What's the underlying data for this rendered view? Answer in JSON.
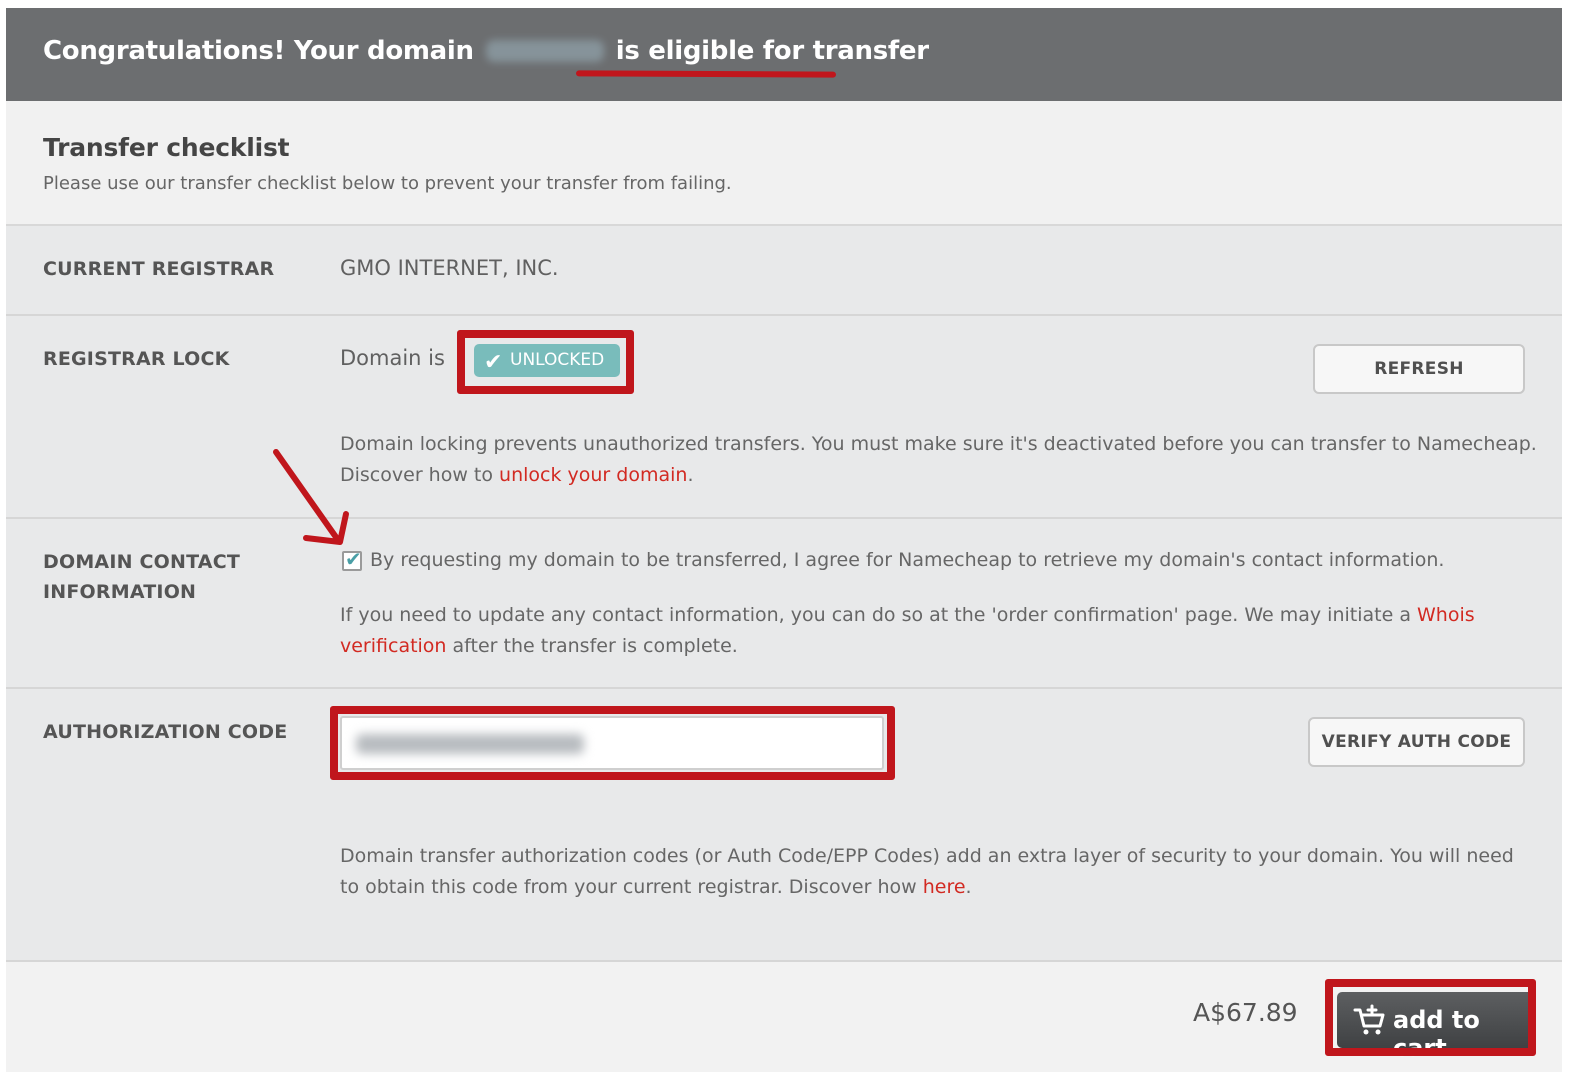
{
  "header": {
    "prefix": "Congratulations! Your domain",
    "suffix": "is eligible for transfer"
  },
  "intro": {
    "title": "Transfer checklist",
    "subtitle": "Please use our transfer checklist below to prevent your transfer from failing."
  },
  "registrar": {
    "label": "CURRENT REGISTRAR",
    "value": "GMO INTERNET, INC."
  },
  "lock": {
    "label": "REGISTRAR LOCK",
    "domain_is": "Domain is",
    "status": "UNLOCKED",
    "refresh_label": "REFRESH",
    "desc": "Domain locking prevents unauthorized transfers. You must make sure it's deactivated before you can transfer to Namecheap.",
    "discover_prefix": "Discover how to",
    "unlock_link": "unlock your domain",
    "period": "."
  },
  "contact": {
    "label_line1": "DOMAIN CONTACT",
    "label_line2": "INFORMATION",
    "agree_text": "By requesting my domain to be transferred, I agree for Namecheap to retrieve my domain's contact information.",
    "info_prefix": "If you need to update any contact information, you can do so at the 'order confirmation' page. We may initiate a",
    "whois_link": "Whois verification",
    "info_suffix": "after the transfer is complete."
  },
  "auth": {
    "label": "AUTHORIZATION CODE",
    "verify_label": "VERIFY AUTH CODE",
    "desc": "Domain transfer authorization codes (or Auth Code/EPP Codes) add an extra layer of security to your domain. You will need to obtain this code from your current registrar. Discover how",
    "here_link": "here",
    "period": "."
  },
  "footer": {
    "price": "A$67.89",
    "cart_label": "add to cart"
  },
  "colors": {
    "header_bg": "#6c6e70",
    "badge": "#79bcbb",
    "link": "#d22a22",
    "annotation": "#c0161c"
  },
  "icons": [
    "check-icon",
    "cart-icon",
    "arrow-annotation"
  ]
}
